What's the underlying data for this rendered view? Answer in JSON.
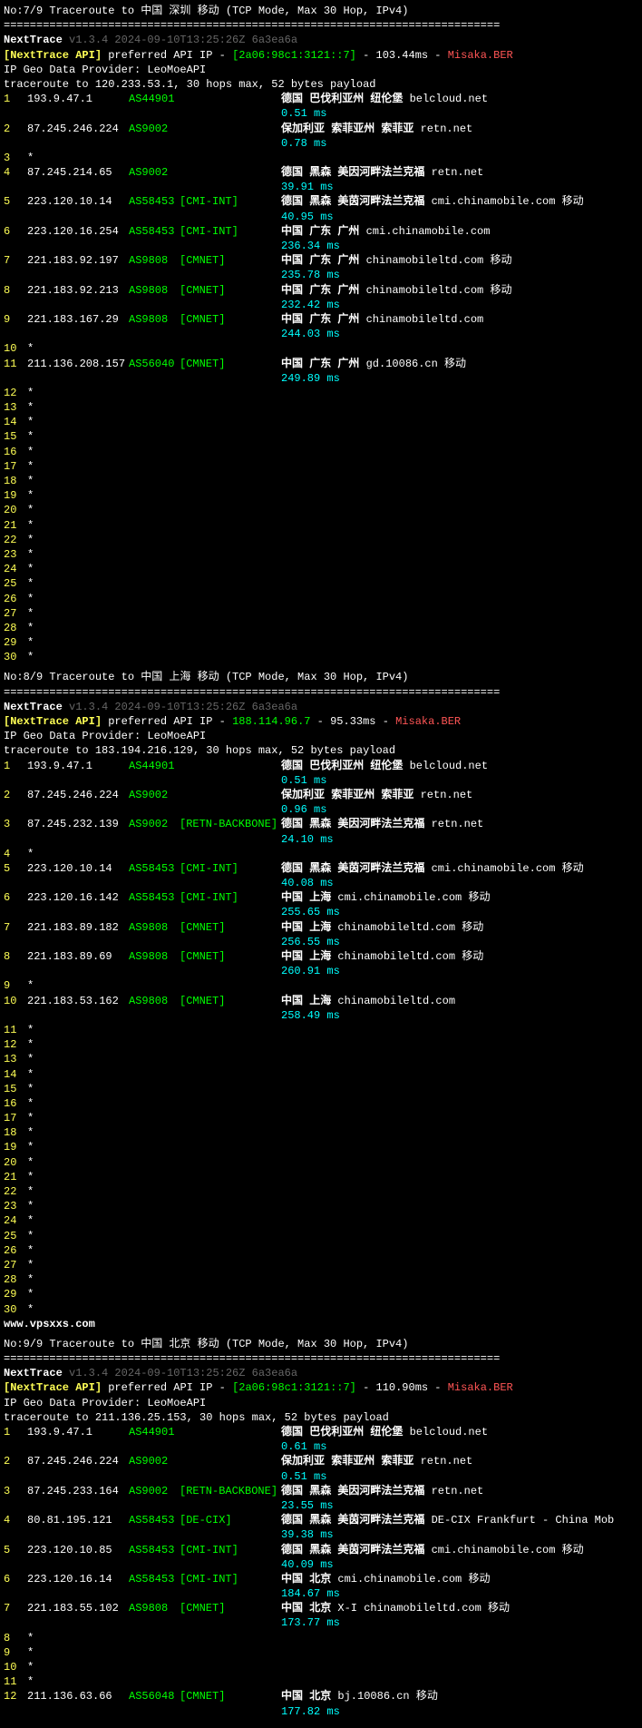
{
  "traces": [
    {
      "title": "No:7/9 Traceroute to 中国 深圳 移动 (TCP Mode, Max 30 Hop, IPv4)",
      "sep": "============================================================================",
      "ver_prefix": "NextTrace",
      "ver": "v1.3.4 2024-09-10T13:25:26Z 6a3ea6a",
      "api_prefix": "[NextTrace API]",
      "api_mid": " preferred API IP - ",
      "api_ip": "[2a06:98c1:3121::7]",
      "api_lat": " - 103.44ms - ",
      "api_loc": "Misaka.BER",
      "provider": "IP Geo Data Provider: LeoMoeAPI",
      "tracehdr": "traceroute to 120.233.53.1, 30 hops max, 52 bytes payload",
      "hops": [
        {
          "n": "1",
          "ip": "193.9.47.1",
          "asn": "AS44901",
          "tag": "",
          "loc": "德国 巴伐利亚州 纽伦堡",
          "dom": "belcloud.net",
          "car": "",
          "ms": "0.51 ms"
        },
        {
          "n": "2",
          "ip": "87.245.246.224",
          "asn": "AS9002",
          "tag": "",
          "loc": "保加利亚 索菲亚州 索菲亚",
          "dom": "retn.net",
          "car": "",
          "ms": "0.78 ms"
        },
        {
          "n": "3",
          "star": true
        },
        {
          "n": "4",
          "ip": "87.245.214.65",
          "asn": "AS9002",
          "tag": "",
          "loc": "德国 黑森 美因河畔法兰克福",
          "dom": "retn.net",
          "car": "",
          "ms": "39.91 ms"
        },
        {
          "n": "5",
          "ip": "223.120.10.14",
          "asn": "AS58453",
          "tag": "[CMI-INT]",
          "loc": "德国 黑森 美茵河畔法兰克福",
          "dom": "cmi.chinamobile.com",
          "car": "移动",
          "ms": "40.95 ms"
        },
        {
          "n": "6",
          "ip": "223.120.16.254",
          "asn": "AS58453",
          "tag": "[CMI-INT]",
          "loc": "中国 广东 广州",
          "dom": "cmi.chinamobile.com",
          "car": "",
          "ms": "236.34 ms"
        },
        {
          "n": "7",
          "ip": "221.183.92.197",
          "asn": "AS9808",
          "tag": "[CMNET]",
          "loc": "中国 广东 广州",
          "dom": "chinamobileltd.com",
          "car": "移动",
          "ms": "235.78 ms"
        },
        {
          "n": "8",
          "ip": "221.183.92.213",
          "asn": "AS9808",
          "tag": "[CMNET]",
          "loc": "中国 广东 广州",
          "dom": "chinamobileltd.com",
          "car": "移动",
          "ms": "232.42 ms"
        },
        {
          "n": "9",
          "ip": "221.183.167.29",
          "asn": "AS9808",
          "tag": "[CMNET]",
          "loc": "中国 广东 广州",
          "dom": "chinamobileltd.com",
          "car": "",
          "ms": "244.03 ms"
        },
        {
          "n": "10",
          "star": true
        },
        {
          "n": "11",
          "ip": "211.136.208.157",
          "asn": "AS56040",
          "tag": "[CMNET]",
          "loc": "中国 广东 广州",
          "dom": "gd.10086.cn",
          "car": "移动",
          "ms": "249.89 ms"
        },
        {
          "n": "12",
          "star": true
        },
        {
          "n": "13",
          "star": true
        },
        {
          "n": "14",
          "star": true
        },
        {
          "n": "15",
          "star": true
        },
        {
          "n": "16",
          "star": true
        },
        {
          "n": "17",
          "star": true
        },
        {
          "n": "18",
          "star": true
        },
        {
          "n": "19",
          "star": true
        },
        {
          "n": "20",
          "star": true
        },
        {
          "n": "21",
          "star": true
        },
        {
          "n": "22",
          "star": true
        },
        {
          "n": "23",
          "star": true
        },
        {
          "n": "24",
          "star": true
        },
        {
          "n": "25",
          "star": true
        },
        {
          "n": "26",
          "star": true
        },
        {
          "n": "27",
          "star": true
        },
        {
          "n": "28",
          "star": true
        },
        {
          "n": "29",
          "star": true
        },
        {
          "n": "30",
          "star": true
        }
      ]
    },
    {
      "title": "No:8/9 Traceroute to 中国 上海 移动 (TCP Mode, Max 30 Hop, IPv4)",
      "sep": "============================================================================",
      "ver_prefix": "NextTrace",
      "ver": "v1.3.4 2024-09-10T13:25:26Z 6a3ea6a",
      "api_prefix": "[NextTrace API]",
      "api_mid": " preferred API IP - ",
      "api_ip": "188.114.96.7",
      "api_lat": " - 95.33ms - ",
      "api_loc": "Misaka.BER",
      "provider": "IP Geo Data Provider: LeoMoeAPI",
      "tracehdr": "traceroute to 183.194.216.129, 30 hops max, 52 bytes payload",
      "hops": [
        {
          "n": "1",
          "ip": "193.9.47.1",
          "asn": "AS44901",
          "tag": "",
          "loc": "德国 巴伐利亚州 纽伦堡",
          "dom": "belcloud.net",
          "car": "",
          "ms": "0.51 ms"
        },
        {
          "n": "2",
          "ip": "87.245.246.224",
          "asn": "AS9002",
          "tag": "",
          "loc": "保加利亚 索菲亚州 索菲亚",
          "dom": "retn.net",
          "car": "",
          "ms": "0.96 ms"
        },
        {
          "n": "3",
          "ip": "87.245.232.139",
          "asn": "AS9002",
          "tag": "[RETN-BACKBONE]",
          "loc": "德国 黑森 美因河畔法兰克福",
          "dom": "retn.net",
          "car": "",
          "ms": "24.10 ms"
        },
        {
          "n": "4",
          "star": true
        },
        {
          "n": "5",
          "ip": "223.120.10.14",
          "asn": "AS58453",
          "tag": "[CMI-INT]",
          "loc": "德国 黑森 美茵河畔法兰克福",
          "dom": "cmi.chinamobile.com",
          "car": "移动",
          "ms": "40.08 ms"
        },
        {
          "n": "6",
          "ip": "223.120.16.142",
          "asn": "AS58453",
          "tag": "[CMI-INT]",
          "loc": "中国 上海",
          "dom": "cmi.chinamobile.com",
          "car": "移动",
          "ms": "255.65 ms"
        },
        {
          "n": "7",
          "ip": "221.183.89.182",
          "asn": "AS9808",
          "tag": "[CMNET]",
          "loc": "中国 上海",
          "dom": "chinamobileltd.com",
          "car": "移动",
          "ms": "256.55 ms"
        },
        {
          "n": "8",
          "ip": "221.183.89.69",
          "asn": "AS9808",
          "tag": "[CMNET]",
          "loc": "中国 上海",
          "dom": "chinamobileltd.com",
          "car": "移动",
          "ms": "260.91 ms"
        },
        {
          "n": "9",
          "star": true
        },
        {
          "n": "10",
          "ip": "221.183.53.162",
          "asn": "AS9808",
          "tag": "[CMNET]",
          "loc": "中国 上海",
          "dom": "chinamobileltd.com",
          "car": "",
          "ms": "258.49 ms"
        },
        {
          "n": "11",
          "star": true
        },
        {
          "n": "12",
          "star": true
        },
        {
          "n": "13",
          "star": true
        },
        {
          "n": "14",
          "star": true
        },
        {
          "n": "15",
          "star": true
        },
        {
          "n": "16",
          "star": true
        },
        {
          "n": "17",
          "star": true
        },
        {
          "n": "18",
          "star": true
        },
        {
          "n": "19",
          "star": true
        },
        {
          "n": "20",
          "star": true
        },
        {
          "n": "21",
          "star": true
        },
        {
          "n": "22",
          "star": true
        },
        {
          "n": "23",
          "star": true
        },
        {
          "n": "24",
          "star": true
        },
        {
          "n": "25",
          "star": true
        },
        {
          "n": "26",
          "star": true
        },
        {
          "n": "27",
          "star": true
        },
        {
          "n": "28",
          "star": true
        },
        {
          "n": "29",
          "star": true
        },
        {
          "n": "30",
          "star": true
        }
      ],
      "watermark": "www.vpsxxs.com"
    },
    {
      "title": "No:9/9 Traceroute to 中国 北京 移动 (TCP Mode, Max 30 Hop, IPv4)",
      "sep": "============================================================================",
      "ver_prefix": "NextTrace",
      "ver": "v1.3.4 2024-09-10T13:25:26Z 6a3ea6a",
      "api_prefix": "[NextTrace API]",
      "api_mid": " preferred API IP - ",
      "api_ip": "[2a06:98c1:3121::7]",
      "api_lat": " - 110.90ms - ",
      "api_loc": "Misaka.BER",
      "provider": "IP Geo Data Provider: LeoMoeAPI",
      "tracehdr": "traceroute to 211.136.25.153, 30 hops max, 52 bytes payload",
      "hops": [
        {
          "n": "1",
          "ip": "193.9.47.1",
          "asn": "AS44901",
          "tag": "",
          "loc": "德国 巴伐利亚州 纽伦堡",
          "dom": "belcloud.net",
          "car": "",
          "ms": "0.61 ms"
        },
        {
          "n": "2",
          "ip": "87.245.246.224",
          "asn": "AS9002",
          "tag": "",
          "loc": "保加利亚 索菲亚州 索菲亚",
          "dom": "retn.net",
          "car": "",
          "ms": "0.51 ms"
        },
        {
          "n": "3",
          "ip": "87.245.233.164",
          "asn": "AS9002",
          "tag": "[RETN-BACKBONE]",
          "loc": "德国 黑森 美因河畔法兰克福",
          "dom": "retn.net",
          "car": "",
          "ms": "23.55 ms"
        },
        {
          "n": "4",
          "ip": "80.81.195.121",
          "asn": "AS58453",
          "tag": "[DE-CIX]",
          "loc": "德国 黑森 美茵河畔法兰克福",
          "dom": "DE-CIX Frankfurt - China Mob",
          "car": "",
          "ms": "39.38 ms"
        },
        {
          "n": "5",
          "ip": "223.120.10.85",
          "asn": "AS58453",
          "tag": "[CMI-INT]",
          "loc": "德国 黑森 美茵河畔法兰克福",
          "dom": "cmi.chinamobile.com",
          "car": "移动",
          "ms": "40.09 ms"
        },
        {
          "n": "6",
          "ip": "223.120.16.14",
          "asn": "AS58453",
          "tag": "[CMI-INT]",
          "loc": "中国 北京",
          "dom": "cmi.chinamobile.com",
          "car": "移动",
          "ms": "184.67 ms"
        },
        {
          "n": "7",
          "ip": "221.183.55.102",
          "asn": "AS9808",
          "tag": "[CMNET]",
          "loc": "中国 北京",
          "dom": "X-I chinamobileltd.com",
          "car": "移动",
          "ms": "173.77 ms"
        },
        {
          "n": "8",
          "star": true
        },
        {
          "n": "9",
          "star": true
        },
        {
          "n": "10",
          "star": true
        },
        {
          "n": "11",
          "star": true
        },
        {
          "n": "12",
          "ip": "211.136.63.66",
          "asn": "AS56048",
          "tag": "[CMNET]",
          "loc": "中国 北京",
          "dom": "bj.10086.cn",
          "car": "移动",
          "ms": "177.82 ms"
        }
      ]
    }
  ]
}
